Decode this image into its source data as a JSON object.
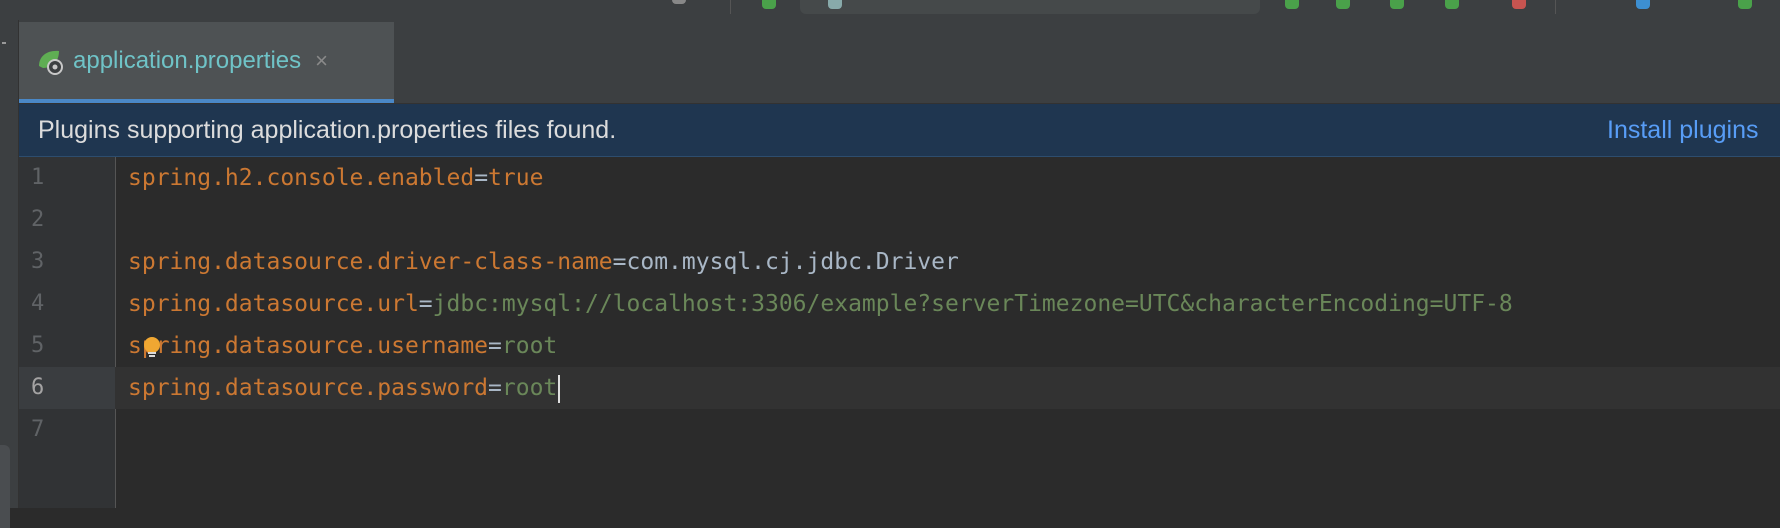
{
  "tab": {
    "label": "application.properties",
    "close_glyph": "×",
    "icon": "spring-leaf-settings-icon"
  },
  "banner": {
    "message": "Plugins supporting application.properties files found.",
    "action": "Install plugins"
  },
  "editor": {
    "current_line": 6,
    "lines": [
      {
        "number": "1",
        "key": "spring.h2.console.enabled",
        "eq": "=",
        "value": "true"
      },
      {
        "number": "2",
        "key": "",
        "eq": "",
        "value": ""
      },
      {
        "number": "3",
        "key": "spring.datasource.driver-class-name",
        "eq": "=",
        "value": "com.mysql.cj.jdbc.Driver"
      },
      {
        "number": "4",
        "key": "spring.datasource.url",
        "eq": "=",
        "value": "jdbc:mysql://localhost:3306/example?serverTimezone=UTC&characterEncoding=UTF-8"
      },
      {
        "number": "5",
        "key": "spring.datasource.username",
        "eq": "=",
        "value": "root"
      },
      {
        "number": "6",
        "key": "spring.datasource.password",
        "eq": "=",
        "value": "root"
      },
      {
        "number": "7",
        "key": "",
        "eq": "",
        "value": ""
      }
    ]
  },
  "colors": {
    "key": "#cc7832",
    "value_string": "#6a8759",
    "value_plain": "#a9b7c6",
    "tab_text": "#6fc3c7",
    "link": "#589df6",
    "banner_bg": "#1f3650",
    "bulb": "#f0a732"
  }
}
